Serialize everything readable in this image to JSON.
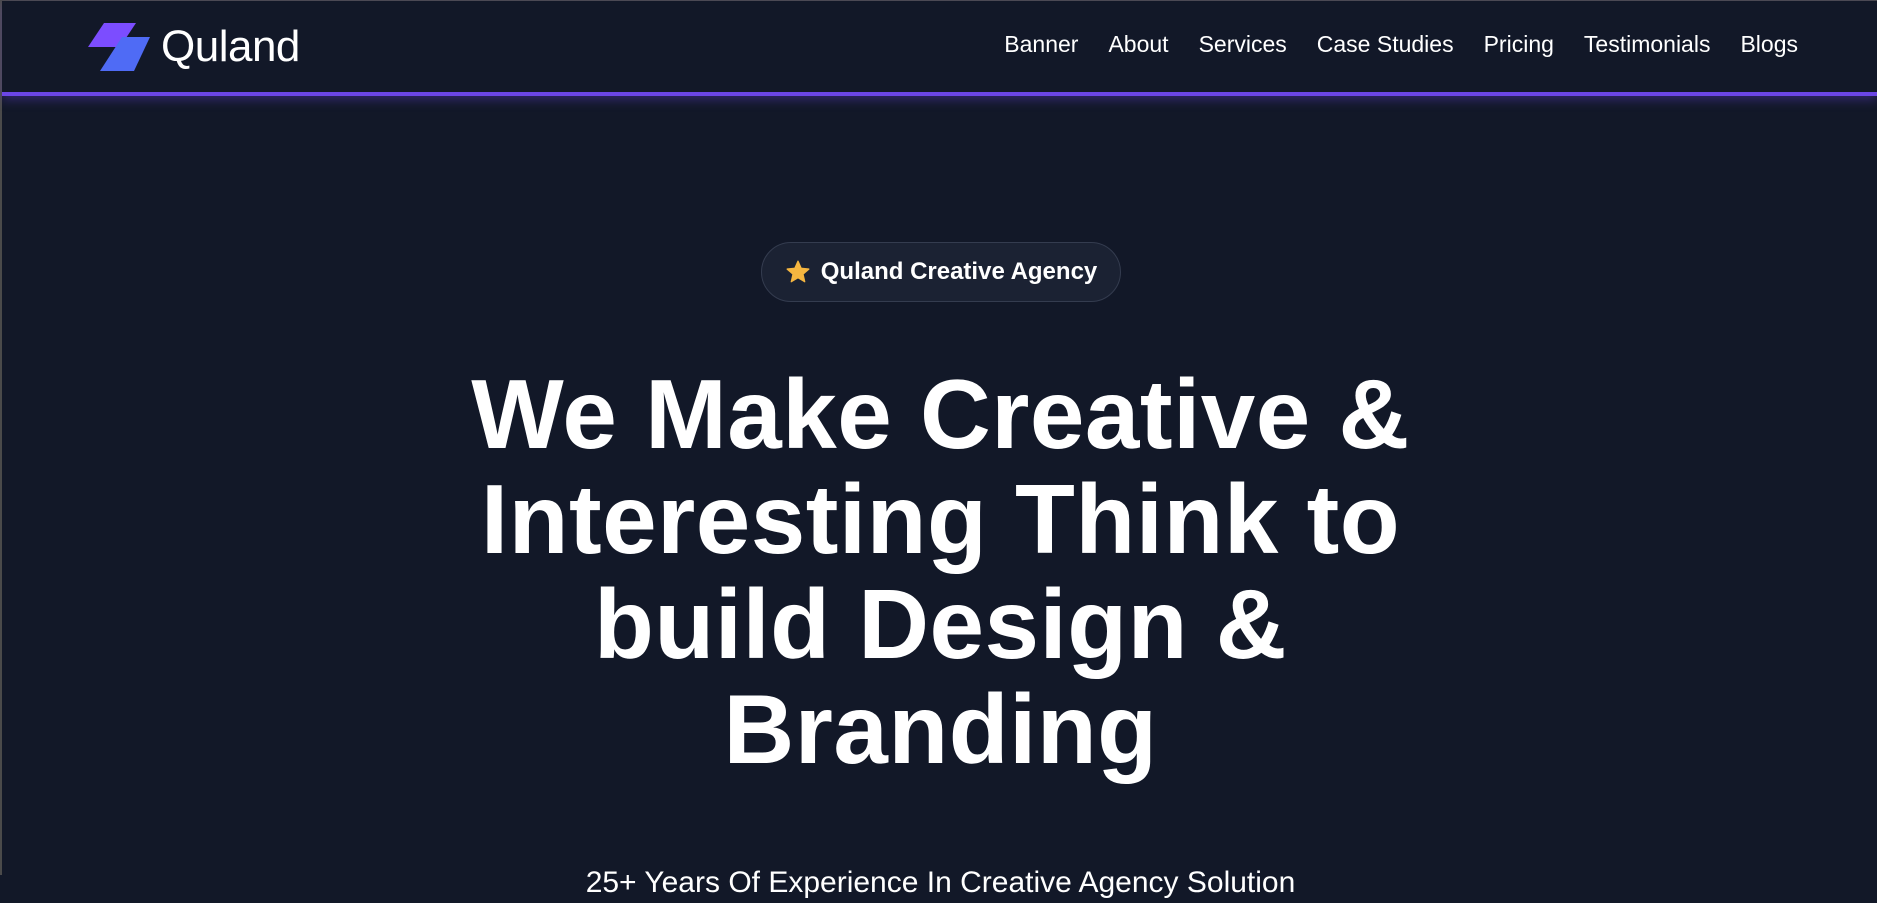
{
  "brand": {
    "name": "Quland",
    "logo_icon": "quland-logo-icon",
    "logo_colors": [
      "#7c4dff",
      "#4f6bf5"
    ]
  },
  "nav": {
    "items": [
      {
        "label": "Banner"
      },
      {
        "label": "About"
      },
      {
        "label": "Services"
      },
      {
        "label": "Case Studies"
      },
      {
        "label": "Pricing"
      },
      {
        "label": "Testimonials"
      },
      {
        "label": "Blogs"
      }
    ]
  },
  "hero": {
    "badge": {
      "icon": "star-icon",
      "text": "Quland Creative Agency"
    },
    "title_lines": [
      "We Make Creative &",
      "Interesting Think to",
      "build Design &",
      "Branding"
    ],
    "subtitle": "25+ Years Of Experience In Creative Agency Solution"
  },
  "colors": {
    "background": "#121828",
    "accent": "#6b46e6",
    "star": "#f5b640",
    "text": "#ffffff"
  }
}
